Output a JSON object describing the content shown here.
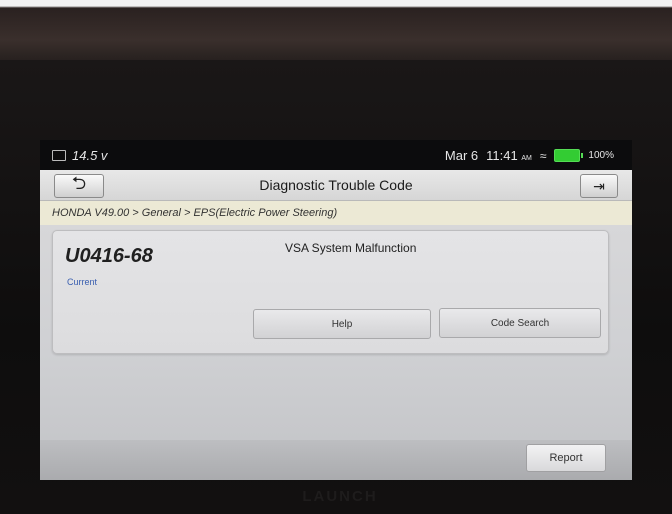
{
  "status_bar": {
    "voltage": "14.5 v",
    "date": "Mar 6",
    "time": "11:41",
    "ampm": "AM",
    "battery_pct": "100%"
  },
  "title_bar": {
    "title": "Diagnostic Trouble Code"
  },
  "breadcrumb": "HONDA V49.00 > General > EPS(Electric Power Steering)",
  "dtc": {
    "code": "U0416-68",
    "status": "Current",
    "description": "VSA System Malfunction",
    "help_label": "Help",
    "code_search_label": "Code Search"
  },
  "bottom_bar": {
    "report_label": "Report"
  },
  "device": {
    "brand": "LAUNCH"
  },
  "colors": {
    "breadcrumb_bg": "#ece9d5",
    "status_text": "#3a5fb0",
    "battery": "#33cc33"
  }
}
